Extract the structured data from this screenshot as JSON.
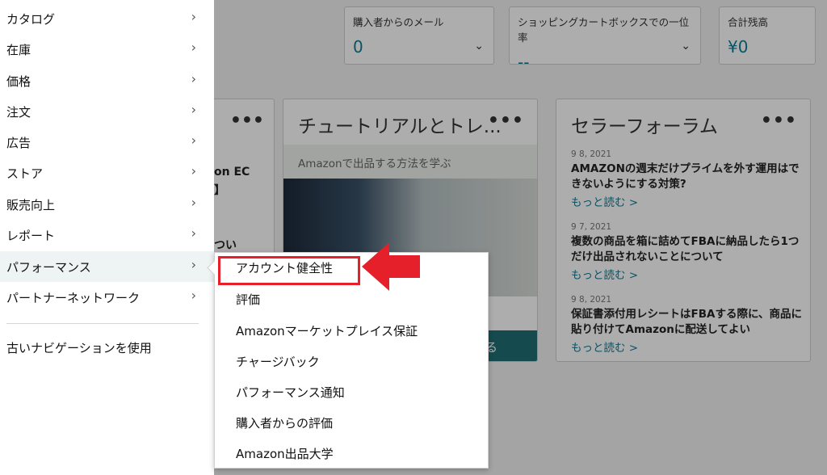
{
  "nav": {
    "items": [
      {
        "label": "カタログ"
      },
      {
        "label": "在庫"
      },
      {
        "label": "価格"
      },
      {
        "label": "注文"
      },
      {
        "label": "広告"
      },
      {
        "label": "ストア"
      },
      {
        "label": "販売向上"
      },
      {
        "label": "レポート"
      },
      {
        "label": "パフォーマンス"
      },
      {
        "label": "パートナーネットワーク"
      }
    ],
    "legacy_label": "古いナビゲーションを使用"
  },
  "submenu": {
    "items": [
      {
        "label": "アカウント健全性"
      },
      {
        "label": "評価"
      },
      {
        "label": "Amazonマーケットプレイス保証"
      },
      {
        "label": "チャージバック"
      },
      {
        "label": "パフォーマンス通知"
      },
      {
        "label": "購入者からの評価"
      },
      {
        "label": "Amazon出品大学"
      }
    ]
  },
  "metrics": [
    {
      "label": "購入者からのメール",
      "value": "0"
    },
    {
      "label": "ショッピングカートボックスでの一位率",
      "value": "--"
    },
    {
      "label": "合計残高",
      "value": "¥0"
    }
  ],
  "cards": {
    "left_fragments": [
      "on EC",
      "】",
      "つい"
    ],
    "tutorial": {
      "title": "チュートリアルとトレ...",
      "banner": "Amazonで出品する方法を学ぶ",
      "button_fragment": "る"
    },
    "forum": {
      "title": "セラーフォーラム",
      "posts": [
        {
          "date": "9 8, 2021",
          "title": "AMAZONの週末だけプライムを外す運用はできないようにする対策?",
          "more": "もっと読む >"
        },
        {
          "date": "9 7, 2021",
          "title": "複数の商品を箱に詰めてFBAに納品したら1つだけ出品されないことについて",
          "more": "もっと読む >"
        },
        {
          "date": "9 8, 2021",
          "title": "保証書添付用レシートはFBAする際に、商品に貼り付けてAmazonに配送してよい",
          "more": "もっと読む >"
        }
      ]
    },
    "dots": "•••"
  },
  "colors": {
    "highlight_border": "#e5202a",
    "arrow": "#e5202a",
    "link": "#0e7c95"
  }
}
